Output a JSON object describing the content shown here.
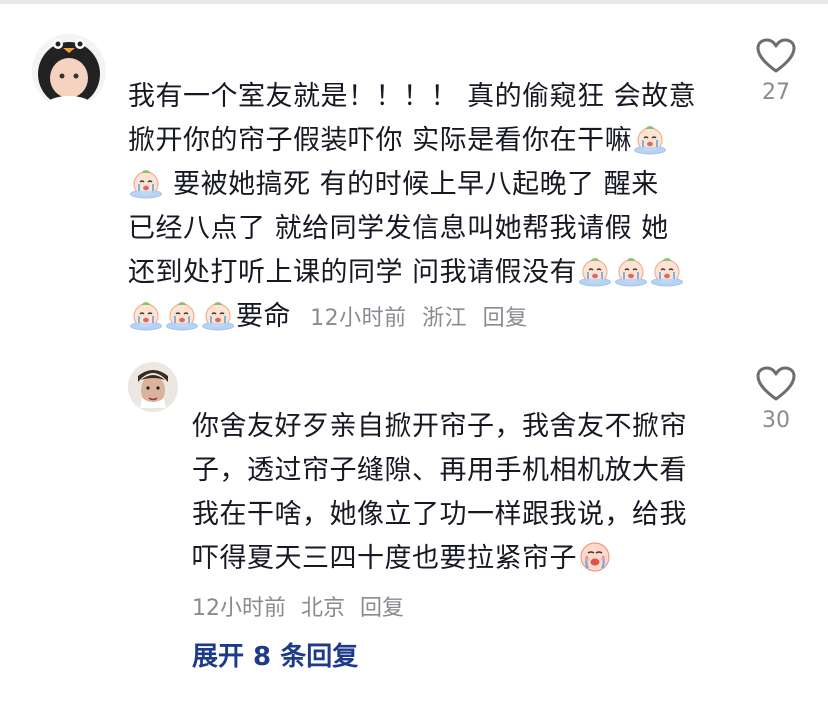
{
  "comments": [
    {
      "lines": [
        "我有一个室友就是！！！！ 真的偷窥狂  会故意",
        "掀开你的帘子假装吓你  实际是看你在干嘛",
        "要被她搞死  有的时候上早八起晚了  醒来",
        "已经八点了  就给同学发信息叫她帮我请假  她",
        "还到处打听上课的同学  问我请假没有",
        "要命"
      ],
      "time": "12小时前",
      "location": "浙江",
      "reply": "回复",
      "likes": "27",
      "avatar_icon": "penguin-hood-avatar",
      "emoji": "crying-baby-emoji"
    },
    {
      "lines": [
        "你舍友好歹亲自掀开帘子，我舍友不掀帘",
        "子，透过帘子缝隙、再用手机相机放大看",
        "我在干啥，她像立了功一样跟我说，给我",
        "吓得夏天三四十度也要拉紧帘子"
      ],
      "time": "12小时前",
      "location": "北京",
      "reply": "回复",
      "likes": "30",
      "avatar_icon": "man-portrait-avatar",
      "emoji": "crying-face-emoji"
    }
  ],
  "expand_label": "展开 8 条回复",
  "colors": {
    "text": "#161823",
    "meta": "#8a8b91",
    "link": "#1e3a8a"
  }
}
